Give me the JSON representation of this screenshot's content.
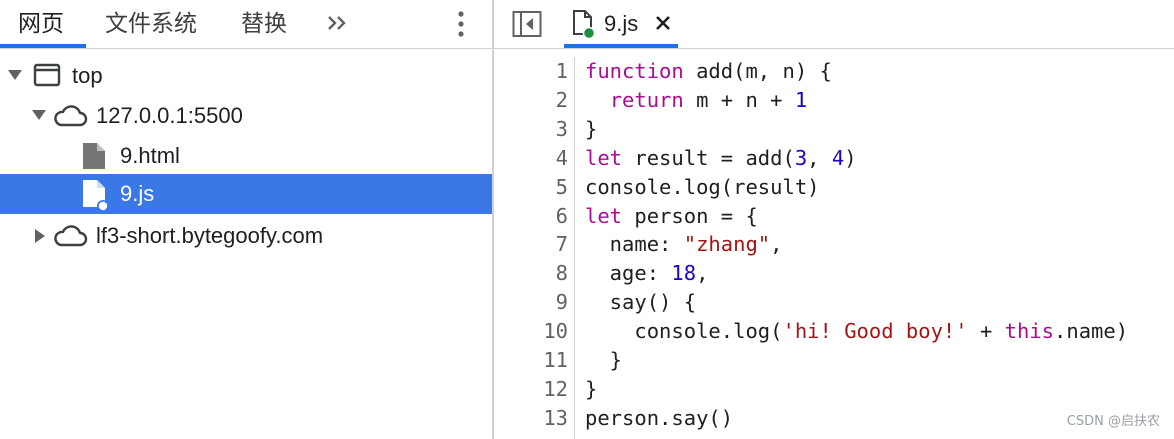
{
  "left_panel": {
    "tabs": [
      {
        "label": "网页",
        "active": true
      },
      {
        "label": "文件系统",
        "active": false
      },
      {
        "label": "替换",
        "active": false
      }
    ],
    "more_tabs_icon": "double-chevron-right-icon",
    "menu_icon": "kebab-menu-icon",
    "tree": [
      {
        "label": "top",
        "icon": "frame-icon",
        "expanded": true
      },
      {
        "label": "127.0.0.1:5500",
        "icon": "cloud-icon",
        "expanded": true
      },
      {
        "label": "9.html",
        "icon": "file-icon"
      },
      {
        "label": "9.js",
        "icon": "file-modified-icon",
        "selected": true
      },
      {
        "label": "lf3-short.bytegoofy.com",
        "icon": "cloud-icon",
        "expanded": false
      }
    ]
  },
  "editor": {
    "toggle_icon": "toggle-navigator-icon",
    "open_tab": {
      "label": "9.js",
      "icon": "file-modified-icon",
      "close_icon": "close-icon"
    },
    "lines": [
      {
        "num": "1",
        "tokens": [
          {
            "t": "function",
            "c": "kw"
          },
          {
            "t": " add(m, n) {",
            "c": ""
          }
        ]
      },
      {
        "num": "2",
        "tokens": [
          {
            "t": "  ",
            "c": ""
          },
          {
            "t": "return",
            "c": "kw"
          },
          {
            "t": " m + n + ",
            "c": ""
          },
          {
            "t": "1",
            "c": "num"
          }
        ]
      },
      {
        "num": "3",
        "tokens": [
          {
            "t": "}",
            "c": ""
          }
        ]
      },
      {
        "num": "4",
        "tokens": [
          {
            "t": "let",
            "c": "kw"
          },
          {
            "t": " result = add(",
            "c": ""
          },
          {
            "t": "3",
            "c": "num"
          },
          {
            "t": ", ",
            "c": ""
          },
          {
            "t": "4",
            "c": "num"
          },
          {
            "t": ")",
            "c": ""
          }
        ]
      },
      {
        "num": "5",
        "tokens": [
          {
            "t": "console.log(result)",
            "c": ""
          }
        ]
      },
      {
        "num": "6",
        "tokens": [
          {
            "t": "let",
            "c": "kw"
          },
          {
            "t": " person = {",
            "c": ""
          }
        ]
      },
      {
        "num": "7",
        "tokens": [
          {
            "t": "  name: ",
            "c": ""
          },
          {
            "t": "\"zhang\"",
            "c": "str"
          },
          {
            "t": ",",
            "c": ""
          }
        ]
      },
      {
        "num": "8",
        "tokens": [
          {
            "t": "  age: ",
            "c": ""
          },
          {
            "t": "18",
            "c": "num"
          },
          {
            "t": ",",
            "c": ""
          }
        ]
      },
      {
        "num": "9",
        "tokens": [
          {
            "t": "  say() {",
            "c": ""
          }
        ]
      },
      {
        "num": "10",
        "tokens": [
          {
            "t": "    console.log(",
            "c": ""
          },
          {
            "t": "'hi! Good boy!'",
            "c": "str2"
          },
          {
            "t": " + ",
            "c": ""
          },
          {
            "t": "this",
            "c": "kw"
          },
          {
            "t": ".name)",
            "c": ""
          }
        ]
      },
      {
        "num": "11",
        "tokens": [
          {
            "t": "  }",
            "c": ""
          }
        ]
      },
      {
        "num": "12",
        "tokens": [
          {
            "t": "}",
            "c": ""
          }
        ]
      },
      {
        "num": "13",
        "tokens": [
          {
            "t": "person.say()",
            "c": ""
          }
        ]
      }
    ]
  },
  "watermark": "CSDN @启扶农",
  "colors": {
    "accent": "#1a73e8",
    "selection": "#3b78e7",
    "keyword": "#aa0d91",
    "number": "#1c00cf",
    "string": "#a31515",
    "modified_dot": "#1e8e3e"
  }
}
